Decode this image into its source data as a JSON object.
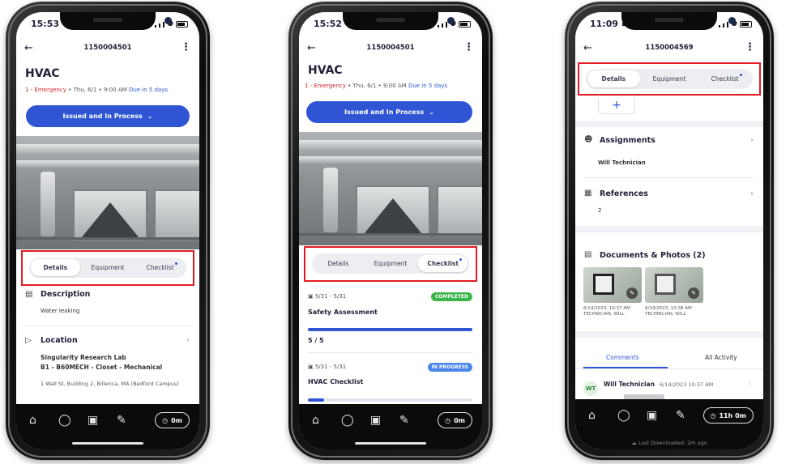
{
  "phone1": {
    "time": "15:53",
    "work_order_id": "1150004501",
    "title": "HVAC",
    "priority": "1 - Emergency",
    "schedule": " • Thu, 6/1 • 9:00 AM ",
    "due": "Due in 5 days",
    "status_button": "Issued and In Process",
    "tabs": [
      {
        "label": "Details",
        "active": true
      },
      {
        "label": "Equipment",
        "active": false
      },
      {
        "label": "Checklist",
        "active": false,
        "dot": true
      }
    ],
    "description_title": "Description",
    "description_text": "Water leaking",
    "location_title": "Location",
    "location_line1": "Singularity Research Lab",
    "location_line2": "B1 - B60MECH - Closet - Mechanical",
    "location_address": "1 Wall St, Building 2, Billerica, MA (Bedford Campus)",
    "timer": "0m"
  },
  "phone2": {
    "time": "15:52",
    "work_order_id": "1150004501",
    "title": "HVAC",
    "priority": "1 - Emergency",
    "schedule": " • Thu, 6/1 • 9:00 AM ",
    "due": "Due in 5 days",
    "status_button": "Issued and In Process",
    "tabs": [
      {
        "label": "Details",
        "active": false
      },
      {
        "label": "Equipment",
        "active": false
      },
      {
        "label": "Checklist",
        "active": true,
        "dot": true
      }
    ],
    "checklists": [
      {
        "dates": "5/31 - 5/31",
        "badge": "COMPLETED",
        "badge_color": "#3bb54a",
        "name": "Safety Assessment",
        "count": "5 / 5",
        "progress": 1.0
      },
      {
        "dates": "5/31 - 5/31",
        "badge": "IN PROGRESS",
        "badge_color": "#4a86e8",
        "name": "HVAC Checklist",
        "count": "",
        "progress": 0.1
      }
    ],
    "timer": "0m"
  },
  "phone3": {
    "time": "11:09",
    "work_order_id": "1150004569",
    "tabs": [
      {
        "label": "Details",
        "active": true
      },
      {
        "label": "Equipment",
        "active": false
      },
      {
        "label": "Checklist",
        "active": false,
        "dot": true
      }
    ],
    "add_symbol": "+",
    "assignments_title": "Assignments",
    "assignee": "Will Technician",
    "references_title": "References",
    "references_count": "2",
    "documents_title": "Documents & Photos (2)",
    "photos": [
      {
        "caption1": "6/14/2023, 10:37 AM",
        "caption2": "TECHNICIAN, WILL"
      },
      {
        "caption1": "6/14/2023, 10:38 AM",
        "caption2": "TECHNICIAN, WILL"
      }
    ],
    "comments_tab": "Comments",
    "activity_tab": "All Activity",
    "comment_initials": "WT",
    "comment_author": "Will Technician",
    "comment_time": "6/14/2023 10:37 AM",
    "timer": "11h 0m",
    "last_downloaded": "Last Downloaded: 2m ago"
  },
  "colors": {
    "accent": "#2f55d4",
    "emergency": "#d8232a",
    "highlight_box": "#e21b23"
  },
  "icons": {
    "back": "back-arrow-icon",
    "more": "more-vertical-icon",
    "home": "home-icon",
    "chat": "chat-icon",
    "camera": "camera-icon",
    "pencil": "pencil-icon",
    "clock": "clock-icon"
  }
}
